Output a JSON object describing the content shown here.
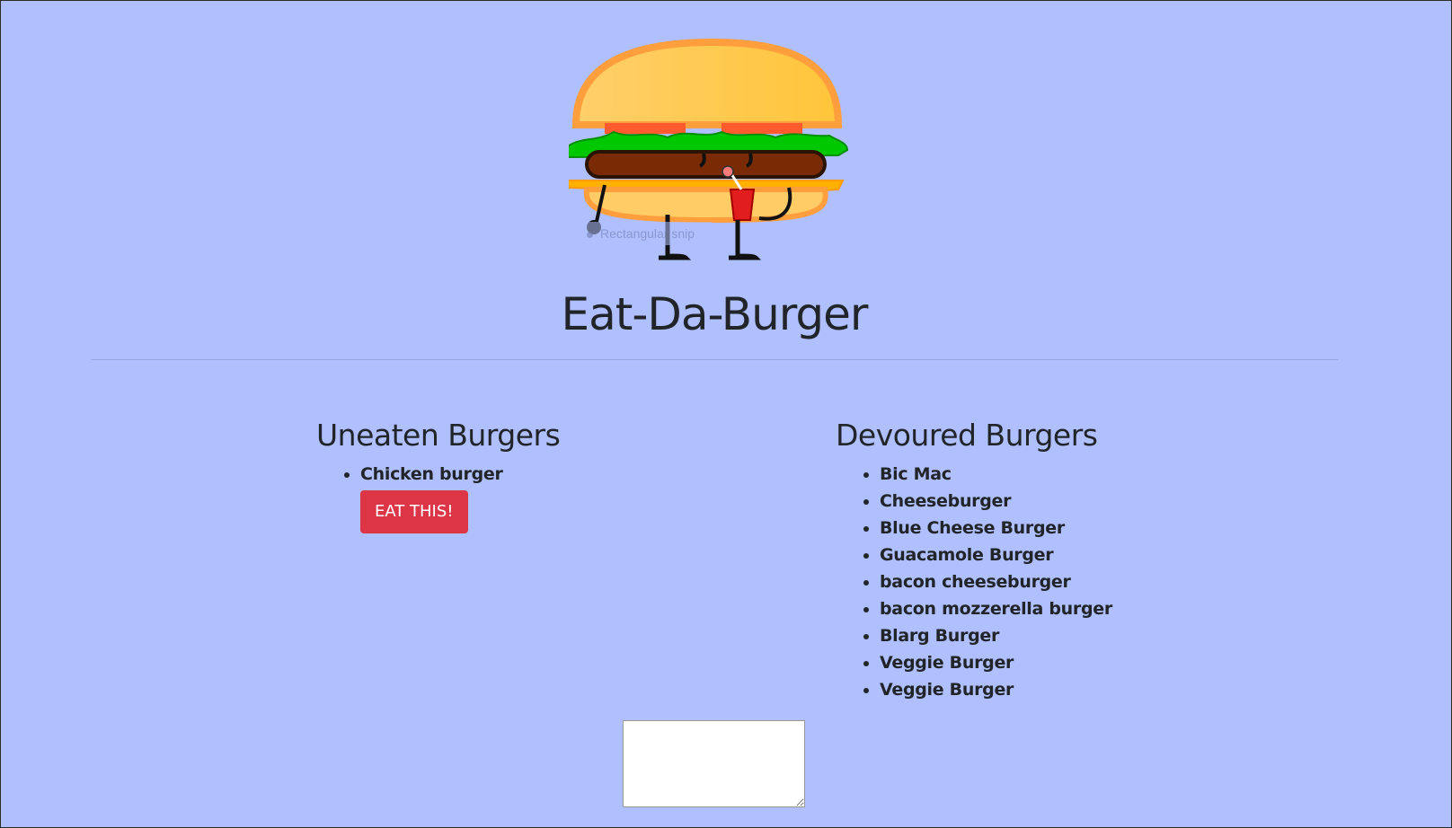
{
  "header": {
    "logo_icon": "burger-mascot-icon",
    "title": "Eat-Da-Burger",
    "snip_overlay_label": "Rectangular snip"
  },
  "uneaten": {
    "heading": "Uneaten Burgers",
    "items": [
      {
        "name": "Chicken burger",
        "button_label": "EAT THIS!"
      }
    ]
  },
  "devoured": {
    "heading": "Devoured Burgers",
    "items": [
      "Bic Mac",
      "Cheeseburger",
      "Blue Cheese Burger",
      "Guacamole Burger",
      "bacon cheeseburger",
      "bacon mozzerella burger",
      "Blarg Burger",
      "Veggie Burger",
      "Veggie Burger"
    ]
  },
  "form": {
    "input_value": "",
    "placeholder": ""
  },
  "colors": {
    "background": "#b0bffd",
    "button": "#dc3545",
    "text": "#212529"
  }
}
